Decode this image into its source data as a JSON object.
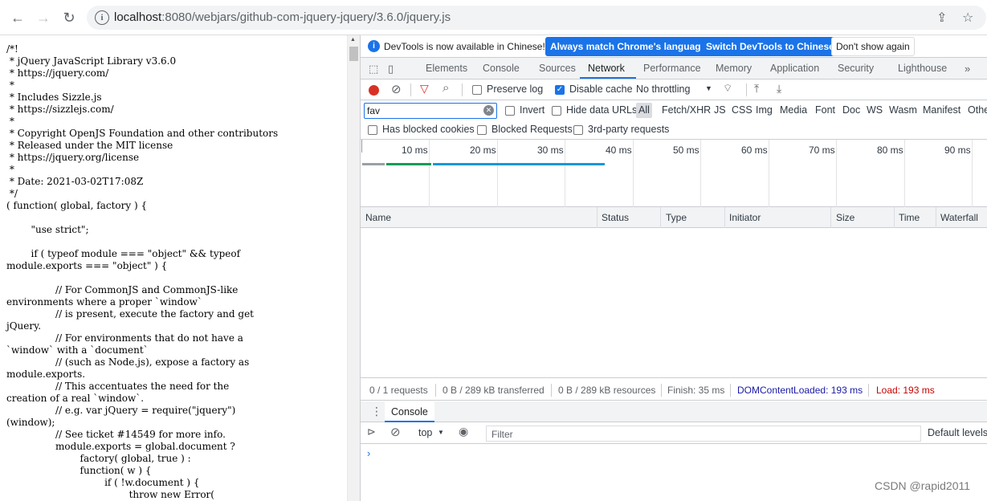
{
  "browser": {
    "url_host": "localhost",
    "url_rest": ":8080/webjars/github-com-jquery-jquery/3.6.0/jquery.js"
  },
  "source_lines": [
    "/*!",
    " * jQuery JavaScript Library v3.6.0",
    " * https://jquery.com/",
    " *",
    " * Includes Sizzle.js",
    " * https://sizzlejs.com/",
    " *",
    " * Copyright OpenJS Foundation and other contributors",
    " * Released under the MIT license",
    " * https://jquery.org/license",
    " *",
    " * Date: 2021-03-02T17:08Z",
    " */",
    "( function( global, factory ) {",
    "",
    "        \"use strict\";",
    "",
    "        if ( typeof module === \"object\" && typeof",
    "module.exports === \"object\" ) {",
    "",
    "                // For CommonJS and CommonJS-like",
    "environments where a proper `window`",
    "                // is present, execute the factory and get",
    "jQuery.",
    "                // For environments that do not have a",
    "`window` with a `document`",
    "                // (such as Node.js), expose a factory as",
    "module.exports.",
    "                // This accentuates the need for the",
    "creation of a real `window`.",
    "                // e.g. var jQuery = require(\"jquery\")",
    "(window);",
    "                // See ticket #14549 for more info.",
    "                module.exports = global.document ?",
    "                        factory( global, true ) :",
    "                        function( w ) {",
    "                                if ( !w.document ) {",
    "                                        throw new Error("
  ],
  "infobar": {
    "text": "DevTools is now available in Chinese!",
    "btn_match": "Always match Chrome's language",
    "btn_switch": "Switch DevTools to Chinese",
    "btn_dont": "Don't show again"
  },
  "tabs": [
    "Elements",
    "Console",
    "Sources",
    "Network",
    "Performance",
    "Memory",
    "Application",
    "Security",
    "Lighthouse"
  ],
  "toolbar": {
    "preserve_log": "Preserve log",
    "disable_cache": "Disable cache",
    "throttling": "No throttling"
  },
  "filter": {
    "value": "fav",
    "invert": "Invert",
    "hide_data_urls": "Hide data URLs",
    "types": [
      "All",
      "Fetch/XHR",
      "JS",
      "CSS",
      "Img",
      "Media",
      "Font",
      "Doc",
      "WS",
      "Wasm",
      "Manifest",
      "Othe"
    ]
  },
  "blockbar": {
    "blocked_cookies": "Has blocked cookies",
    "blocked_requests": "Blocked Requests",
    "third_party": "3rd-party requests"
  },
  "overview": {
    "ticks": [
      "10 ms",
      "20 ms",
      "30 ms",
      "40 ms",
      "50 ms",
      "60 ms",
      "70 ms",
      "80 ms",
      "90 ms"
    ]
  },
  "columns": [
    "Name",
    "Status",
    "Type",
    "Initiator",
    "Size",
    "Time",
    "Waterfall"
  ],
  "status": {
    "requests": "0 / 1 requests",
    "transferred": "0 B / 289 kB transferred",
    "resources": "0 B / 289 kB resources",
    "finish": "Finish: 35 ms",
    "domcontentloaded": "DOMContentLoaded: 193 ms",
    "load": "Load: 193 ms"
  },
  "drawer": {
    "tab": "Console",
    "context": "top",
    "filter_placeholder": "Filter",
    "levels": "Default levels"
  },
  "watermark": "CSDN @rapid2011",
  "colors": {
    "accent": "#1a73e8",
    "record": "#d93025",
    "dcl": "#1a1aa6",
    "load": "#c80000"
  }
}
